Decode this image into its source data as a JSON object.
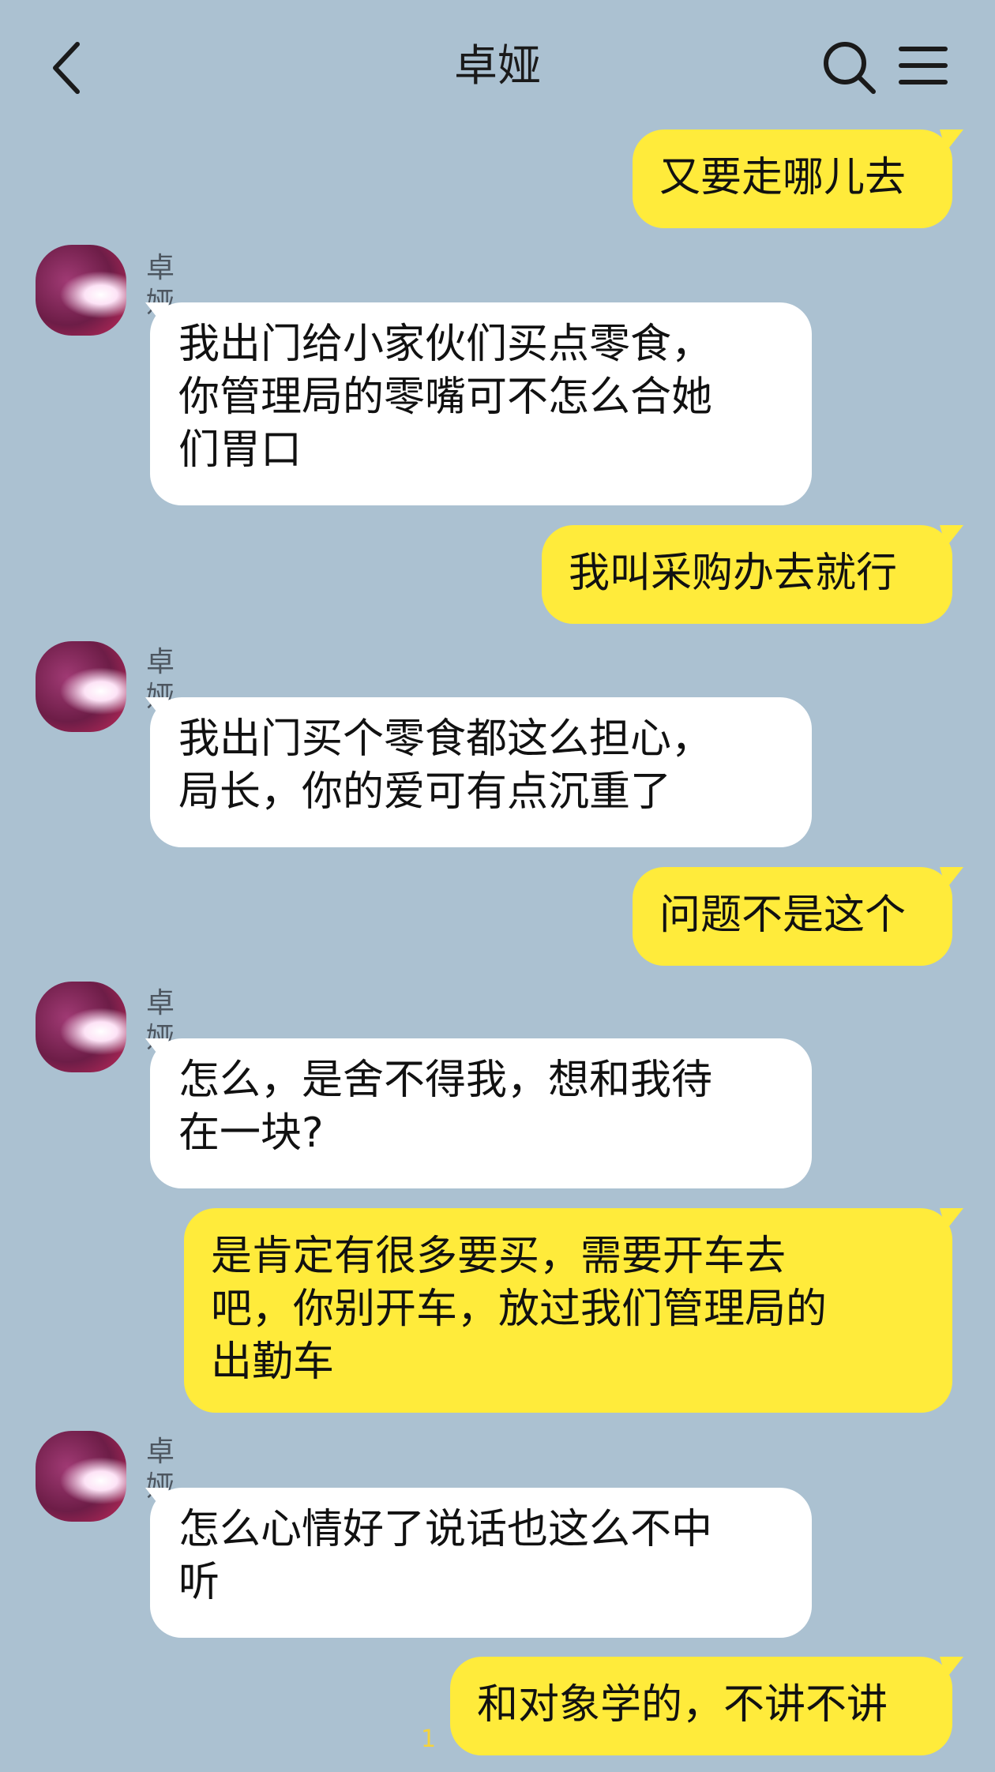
{
  "header": {
    "title": "卓娅",
    "back_icon": "chevron-left-icon",
    "search_icon": "search-icon",
    "menu_icon": "hamburger-menu-icon"
  },
  "colors": {
    "background": "#abc1d1",
    "my_bubble": "#ffeb3b",
    "their_bubble": "#ffffff"
  },
  "messages": [
    {
      "from": "me",
      "text": "又要走哪儿去"
    },
    {
      "from": "other",
      "sender": "卓娅",
      "text": "我出门给小家伙们买点零食，\n你管理局的零嘴可不怎么合她\n们胃口"
    },
    {
      "from": "me",
      "text": "我叫采购办去就行"
    },
    {
      "from": "other",
      "sender": "卓娅",
      "text": "我出门买个零食都这么担心，\n局长，你的爱可有点沉重了"
    },
    {
      "from": "me",
      "text": "问题不是这个"
    },
    {
      "from": "other",
      "sender": "卓娅",
      "text": "怎么，是舍不得我，想和我待\n在一块?"
    },
    {
      "from": "me",
      "text": "是肯定有很多要买，需要开车去\n吧，你别开车，放过我们管理局的\n出勤车"
    },
    {
      "from": "other",
      "sender": "卓娅",
      "text": "怎么心情好了说话也这么不中\n听"
    },
    {
      "from": "me",
      "text": "和对象学的，不讲不讲"
    }
  ],
  "page_indicator": "1"
}
